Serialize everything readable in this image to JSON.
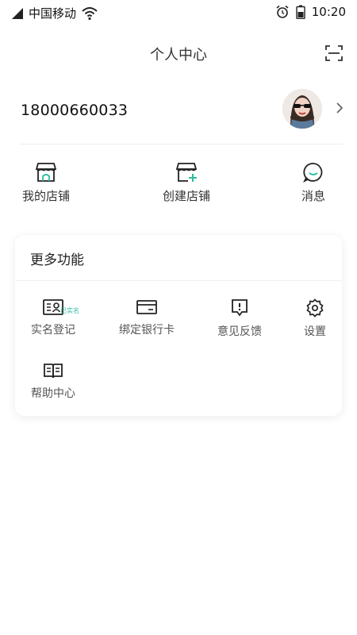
{
  "status_bar": {
    "carrier": "中国移动",
    "time": "10:20",
    "icons": [
      "signal-icon",
      "wifi-icon",
      "alarm-icon",
      "battery-icon"
    ]
  },
  "header": {
    "title": "个人中心",
    "scan_icon": "scan-icon"
  },
  "profile": {
    "phone": "18000660033",
    "avatar": "user-avatar",
    "chevron_icon": "chevron-right-icon"
  },
  "quick_actions": [
    {
      "label": "我的店铺",
      "icon": "store-icon"
    },
    {
      "label": "创建店铺",
      "icon": "create-store-icon"
    },
    {
      "label": "消息",
      "icon": "message-icon"
    }
  ],
  "more_features": {
    "title": "更多功能",
    "items": [
      {
        "label": "实名登记",
        "icon": "id-card-icon",
        "badge": "已实名"
      },
      {
        "label": "绑定银行卡",
        "icon": "bank-card-icon"
      },
      {
        "label": "意见反馈",
        "icon": "feedback-icon"
      },
      {
        "label": "设置",
        "icon": "settings-icon"
      },
      {
        "label": "帮助中心",
        "icon": "help-book-icon"
      }
    ]
  },
  "colors": {
    "accent": "#2bbca0",
    "text": "#222222",
    "muted": "#555555",
    "background": "#ffffff"
  }
}
